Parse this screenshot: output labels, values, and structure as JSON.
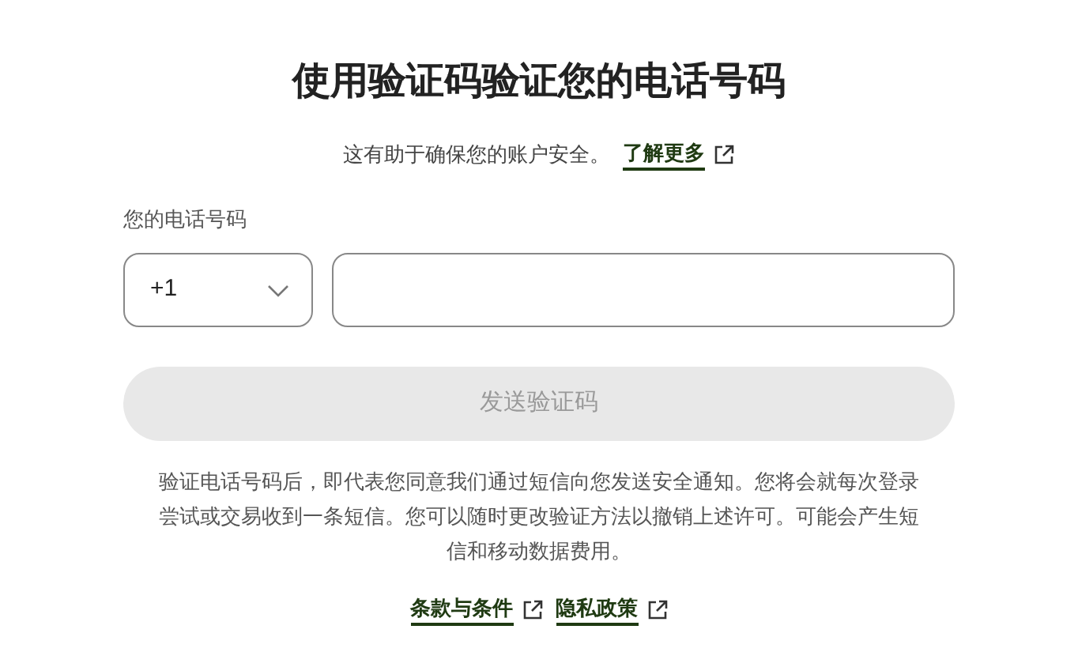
{
  "title": "使用验证码验证您的电话号码",
  "subtitle": {
    "text": "这有助于确保您的账户安全。",
    "link": "了解更多"
  },
  "phone": {
    "label": "您的电话号码",
    "country_code": "+1"
  },
  "send_button": {
    "label": "发送验证码",
    "disabled": true
  },
  "disclaimer": "验证电话号码后，即代表您同意我们通过短信向您发送安全通知。您将会就每次登录尝试或交易收到一条短信。您可以随时更改验证方法以撤销上述许可。可能会产生短信和移动数据费用。",
  "footer_links": [
    "条款与条件",
    "隐私政策"
  ]
}
